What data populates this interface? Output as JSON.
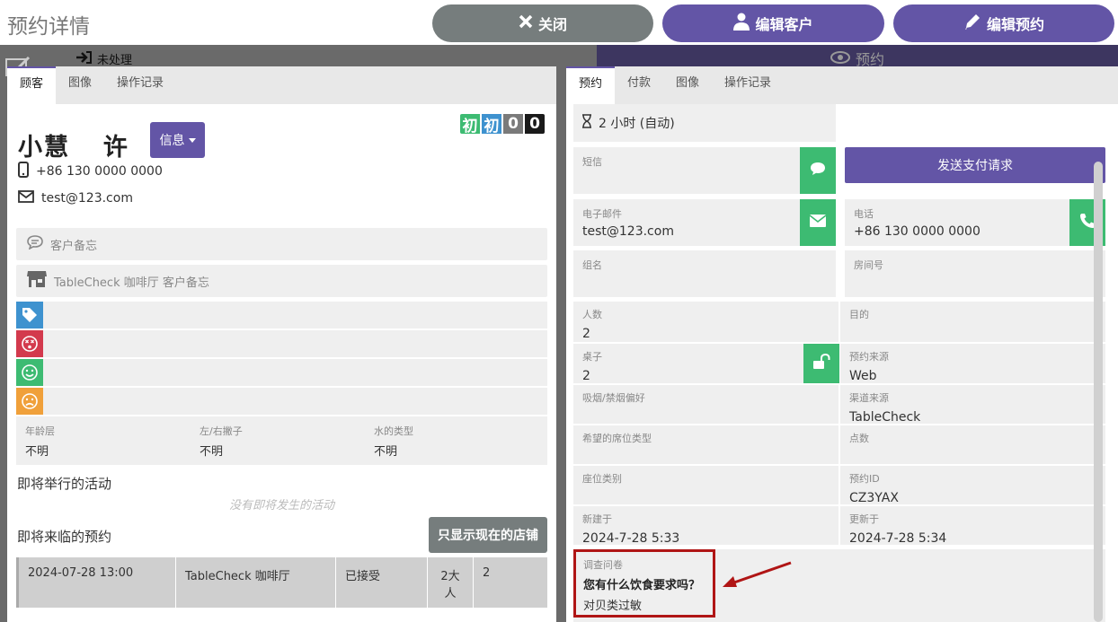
{
  "header": {
    "title": "预约详情",
    "close_label": "关闭",
    "edit_customer_label": "编辑客户",
    "edit_booking_label": "编辑预约"
  },
  "background": {
    "status_text": "未处理",
    "preview_label": "预约"
  },
  "left_panel": {
    "tabs": [
      {
        "label": "顾客",
        "active": true
      },
      {
        "label": "图像",
        "active": false
      },
      {
        "label": "操作记录",
        "active": false
      }
    ],
    "customer": {
      "first_name": "小慧",
      "last_name": "许",
      "info_button": "信息",
      "phone": "+86 130 0000 0000",
      "email": "test@123.com"
    },
    "badges": [
      "初",
      "初",
      "0",
      "0"
    ],
    "notes": {
      "customer_note": "客户备忘",
      "store_note": "TableCheck 咖啡厅 客户备忘"
    },
    "attributes": [
      {
        "label": "年龄层",
        "value": "不明"
      },
      {
        "label": "左/右撇子",
        "value": "不明"
      },
      {
        "label": "水的类型",
        "value": "不明"
      }
    ],
    "upcoming_events_title": "即将举行的活动",
    "no_events_msg": "没有即将发生的活动",
    "upcoming_bookings_title": "即将来临的预约",
    "only_current_store_button": "只显示现在的店铺",
    "bookings": [
      {
        "datetime": "2024-07-28 13:00",
        "store": "TableCheck 咖啡厅",
        "status": "已接受",
        "people": "2大人",
        "count": "2"
      }
    ]
  },
  "right_panel": {
    "tabs": [
      {
        "label": "预约",
        "active": true
      },
      {
        "label": "付款",
        "active": false
      },
      {
        "label": "图像",
        "active": false
      },
      {
        "label": "操作记录",
        "active": false
      }
    ],
    "duration": "2 小时 (自动)",
    "sms_label": "短信",
    "send_payment_button": "发送支付请求",
    "email_label": "电子邮件",
    "email_value": "test@123.com",
    "phone_label": "电话",
    "phone_value": "+86 130 0000 0000",
    "group_name_label": "组名",
    "room_no_label": "房间号",
    "fields": {
      "pax_label": "人数",
      "pax_value": "2",
      "purpose_label": "目的",
      "purpose_value": "",
      "table_label": "桌子",
      "table_value": "2",
      "source_label": "预约来源",
      "source_value": "Web",
      "smoking_label": "吸烟/禁烟偏好",
      "smoking_value": "",
      "channel_label": "渠道来源",
      "channel_value": "TableCheck",
      "seat_type_label": "希望的席位类型",
      "seat_type_value": "",
      "points_label": "点数",
      "points_value": "",
      "seat_category_label": "座位类别",
      "seat_category_value": "",
      "booking_id_label": "预约ID",
      "booking_id_value": "CZ3YAX",
      "created_label": "新建于",
      "created_value": "2024-7-28 5:33",
      "updated_label": "更新于",
      "updated_value": "2024-7-28 5:34"
    },
    "survey": {
      "label": "调查问卷",
      "question": "您有什么饮食要求吗？",
      "answer": "对贝类过敏"
    }
  },
  "colors": {
    "primary": "#6355a6",
    "gray_button": "#767d7d",
    "green": "#3dbb72",
    "blue": "#3e92cf",
    "red": "#d33a4d",
    "orange": "#f0a03a",
    "highlight_red": "#b01515"
  }
}
